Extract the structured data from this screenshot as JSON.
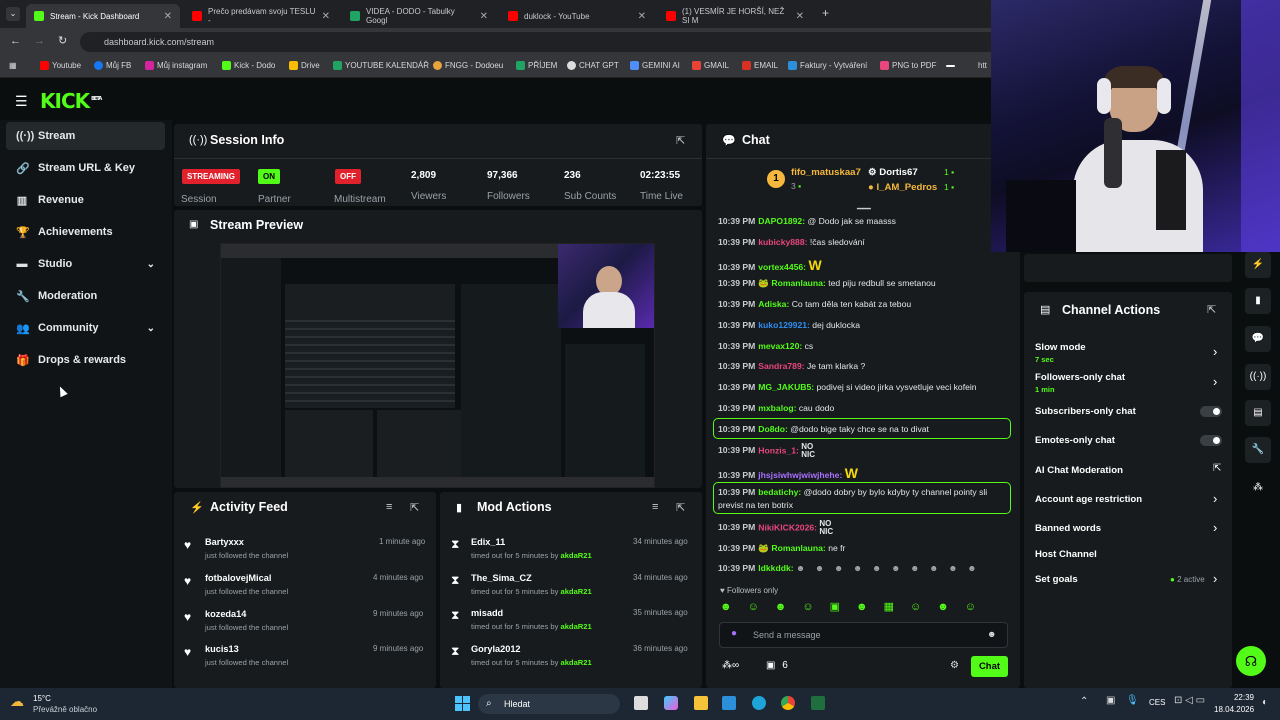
{
  "browser": {
    "tabs": [
      {
        "title": "Stream - Kick Dashboard",
        "color": "#53fc18"
      },
      {
        "title": "Prečo predávam svoju TESLU - ",
        "color": "#ff0000"
      },
      {
        "title": "VIDEA - DODO - Tabulky Googl",
        "color": "#1fa463"
      },
      {
        "title": "duklock - YouTube",
        "color": "#ff0000"
      },
      {
        "title": "(1) VESMÍR JE HORŠÍ, NEŽ SI M",
        "color": "#ff0000"
      }
    ],
    "url": "dashboard.kick.com/stream",
    "bookmarks": [
      "Youtube",
      "Můj FB",
      "Můj instagram",
      "Kick - Dodo",
      "Drive",
      "YOUTUBE KALENDÁŘ",
      "FNGG - Dodoeu",
      "PŘÍJEM",
      "CHAT GPT",
      "GEMINI AI",
      "GMAIL",
      "EMAIL",
      "Faktury - Vytváření",
      "PNG to PDF",
      "htt"
    ]
  },
  "app": {
    "logo": "KICK",
    "beta": "BETA"
  },
  "sidebar": {
    "items": [
      {
        "label": "Stream",
        "icon": "broadcast-icon"
      },
      {
        "label": "Stream URL & Key",
        "icon": "link-icon"
      },
      {
        "label": "Revenue",
        "icon": "chart-icon"
      },
      {
        "label": "Achievements",
        "icon": "trophy-icon"
      },
      {
        "label": "Studio",
        "icon": "studio-icon"
      },
      {
        "label": "Moderation",
        "icon": "wrench-icon"
      },
      {
        "label": "Community",
        "icon": "users-icon"
      },
      {
        "label": "Drops & rewards",
        "icon": "gift-icon"
      }
    ]
  },
  "session": {
    "title": "Session Info",
    "badges": {
      "streaming": "STREAMING",
      "on": "ON",
      "off": "OFF"
    },
    "labels": {
      "session": "Session",
      "partner": "Partner",
      "multistream": "Multistream",
      "viewers": "Viewers",
      "followers": "Followers",
      "subs": "Sub Counts",
      "time": "Time Live"
    },
    "values": {
      "viewers": "2,809",
      "followers": "97,366",
      "subs": "236",
      "time": "02:23:55"
    }
  },
  "preview": {
    "title": "Stream Preview"
  },
  "activity": {
    "title": "Activity Feed",
    "items": [
      {
        "name": "Bartyxxx",
        "desc": "just followed the channel",
        "ago": "1 minute ago"
      },
      {
        "name": "fotbalovejMical",
        "desc": "just followed the channel",
        "ago": "4 minutes ago"
      },
      {
        "name": "kozeda14",
        "desc": "just followed the channel",
        "ago": "9 minutes ago"
      },
      {
        "name": "kucis13",
        "desc": "just followed the channel",
        "ago": "9 minutes ago"
      }
    ]
  },
  "mod": {
    "title": "Mod Actions",
    "items": [
      {
        "name": "Edix_11",
        "desc": "timed out for 5 minutes by ",
        "by": "akdaR21",
        "ago": "34 minutes ago"
      },
      {
        "name": "The_Sima_CZ",
        "desc": "timed out for 5 minutes by ",
        "by": "akdaR21",
        "ago": "34 minutes ago"
      },
      {
        "name": "misadd",
        "desc": "timed out for 5 minutes by ",
        "by": "akdaR21",
        "ago": "35 minutes ago"
      },
      {
        "name": "Goryla2012",
        "desc": "timed out for 5 minutes by ",
        "by": "akdaR21",
        "ago": "36 minutes ago"
      }
    ]
  },
  "chat": {
    "title": "Chat",
    "top": {
      "rank": "1",
      "first": "fifo_matuskaa7",
      "first_count": "3",
      "second": "Dortis67",
      "second_count": "1",
      "third": "I_AM_Pedros",
      "third_count": "1"
    },
    "messages": [
      {
        "time": "10:39 PM",
        "user": "DAPO1892:",
        "color": "#53fc18",
        "text": "@ Dodo jak se maasss"
      },
      {
        "time": "10:39 PM",
        "user": "kubicky888:",
        "color": "#e8467c",
        "text": "!čas sledování"
      },
      {
        "time": "10:39 PM",
        "user": "vortex4456:",
        "color": "#53fc18",
        "text": ""
      },
      {
        "time": "10:39 PM",
        "user": "Romanlauna:",
        "color": "#53fc18",
        "text": "ted piju redbull se smetanou"
      },
      {
        "time": "10:39 PM",
        "user": "Adiska:",
        "color": "#53fc18",
        "text": "Co tam děla ten kabát za tebou"
      },
      {
        "time": "10:39 PM",
        "user": "kuko129921:",
        "color": "#2f8df2",
        "text": "dej duklocka"
      },
      {
        "time": "10:39 PM",
        "user": "mevax120:",
        "color": "#53fc18",
        "text": "cs"
      },
      {
        "time": "10:39 PM",
        "user": "Sandra789:",
        "color": "#e8467c",
        "text": "Je tam klarka ?"
      },
      {
        "time": "10:39 PM",
        "user": "MG_JAKUB5:",
        "color": "#53fc18",
        "text": "podivej si video jirka vysvetluje veci kofein"
      },
      {
        "time": "10:39 PM",
        "user": "mxbalog:",
        "color": "#53fc18",
        "text": "cau dodo"
      },
      {
        "time": "10:39 PM",
        "user": "Do8do:",
        "color": "#53fc18",
        "text": "@dodo bige taky chce se na to divat"
      },
      {
        "time": "10:39 PM",
        "user": "Honzis_1:",
        "color": "#e8467c",
        "text": ""
      },
      {
        "time": "10:39 PM",
        "user": "jhsjsiwhwjwiwjhehe:",
        "color": "#a970ff",
        "text": ""
      },
      {
        "time": "10:39 PM",
        "user": "bedatichy:",
        "color": "#53fc18",
        "text": "@dodo dobry by bylo kdyby ty channel pointy sli"
      },
      {
        "time": "",
        "user": "",
        "color": "#fff",
        "text": "previst na ten botrix"
      },
      {
        "time": "10:39 PM",
        "user": "NikiKICK2026:",
        "color": "#e8467c",
        "text": ""
      },
      {
        "time": "10:39 PM",
        "user": "Romanlauna:",
        "color": "#53fc18",
        "text": "ne fr"
      },
      {
        "time": "10:39 PM",
        "user": "ldkkddk:",
        "color": "#53fc18",
        "text": ""
      }
    ],
    "followers_only": "Followers only",
    "placeholder": "Send a message",
    "send": "Chat",
    "count": "6",
    "emote_nonic": "NO NIC"
  },
  "actions": {
    "title": "Channel Actions",
    "items": [
      {
        "label": "Slow mode",
        "sub": "7 sec"
      },
      {
        "label": "Followers-only chat",
        "sub": "1 min"
      },
      {
        "label": "Subscribers-only chat",
        "sub": ""
      },
      {
        "label": "Emotes-only chat",
        "sub": ""
      },
      {
        "label": "AI Chat Moderation",
        "sub": ""
      },
      {
        "label": "Account age restriction",
        "sub": ""
      },
      {
        "label": "Banned words",
        "sub": ""
      },
      {
        "label": "Host Channel",
        "sub": ""
      },
      {
        "label": "Set goals",
        "sub": ""
      }
    ],
    "goals_active": "2 active"
  },
  "taskbar": {
    "temp": "15°C",
    "weather": "Převážně oblačno",
    "search": "Hledat",
    "lang": "CES",
    "time": "22:39",
    "date": "18.04.2026"
  },
  "colors": {
    "accent": "#53fc18",
    "bg": "#0b0e0f",
    "panel": "#171b1d"
  }
}
